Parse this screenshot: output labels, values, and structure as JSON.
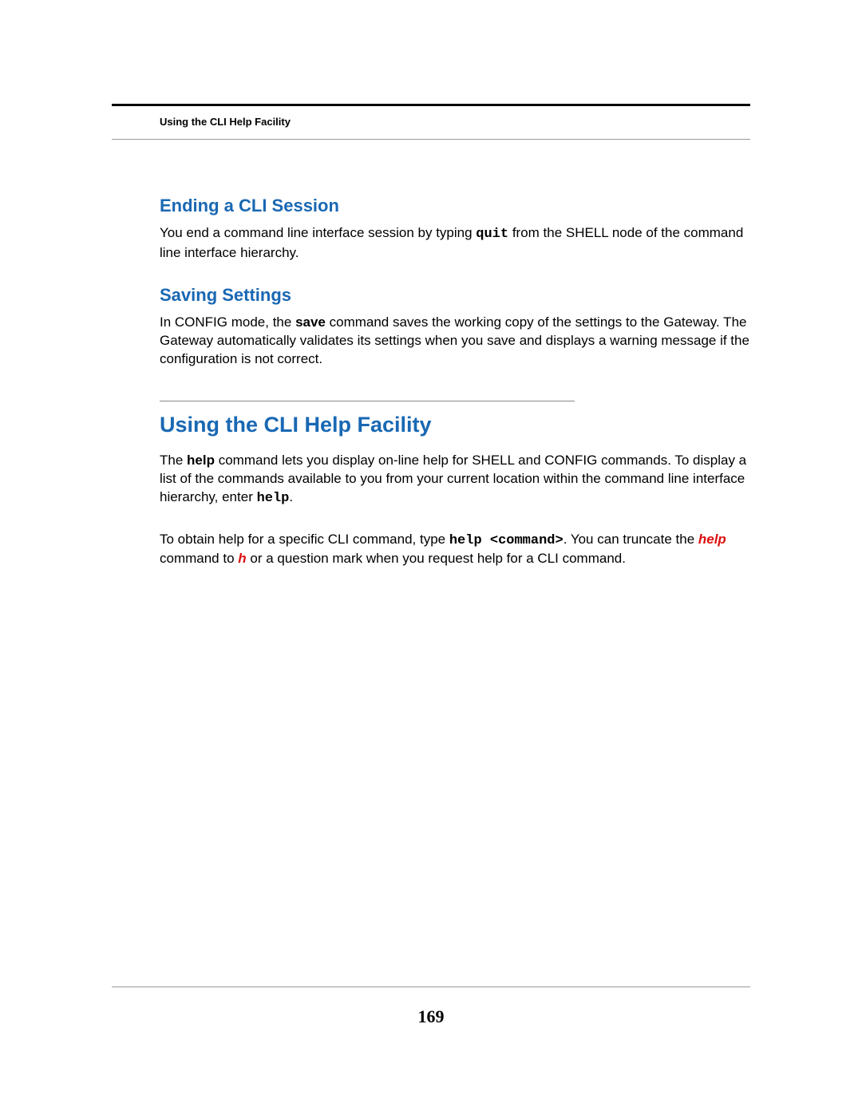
{
  "runningHeader": "Using the CLI Help Facility",
  "sections": {
    "ending": {
      "heading": "Ending a CLI Session",
      "p1a": "You end a command line interface session by typing ",
      "p1_cmd": "quit",
      "p1b": " from the SHELL node of the command line interface hierarchy."
    },
    "saving": {
      "heading": "Saving Settings",
      "p1a": "In CONFIG mode, the ",
      "p1_bold": "save",
      "p1b": " command saves the working copy of the settings to the Gateway. The Gateway automatically validates its settings when you save and displays a warning message if the configuration is not correct."
    },
    "helpFacility": {
      "heading": "Using the CLI Help Facility",
      "p1a": "The ",
      "p1_bold": "help",
      "p1b": " command lets you display on-line help for SHELL and CONFIG commands. To display a list of the commands available to you from your current location within the command line interface hierarchy, enter ",
      "p1_cmd": "help",
      "p1c": ".",
      "p2a": "To obtain help for a specific CLI command, type ",
      "p2_cmd": "help <command>",
      "p2b": ". You can truncate the ",
      "p2_red1": "help",
      "p2c": " command to ",
      "p2_red2": "h",
      "p2d": " or a question mark when you request help for a CLI command."
    }
  },
  "pageNumber": "169"
}
